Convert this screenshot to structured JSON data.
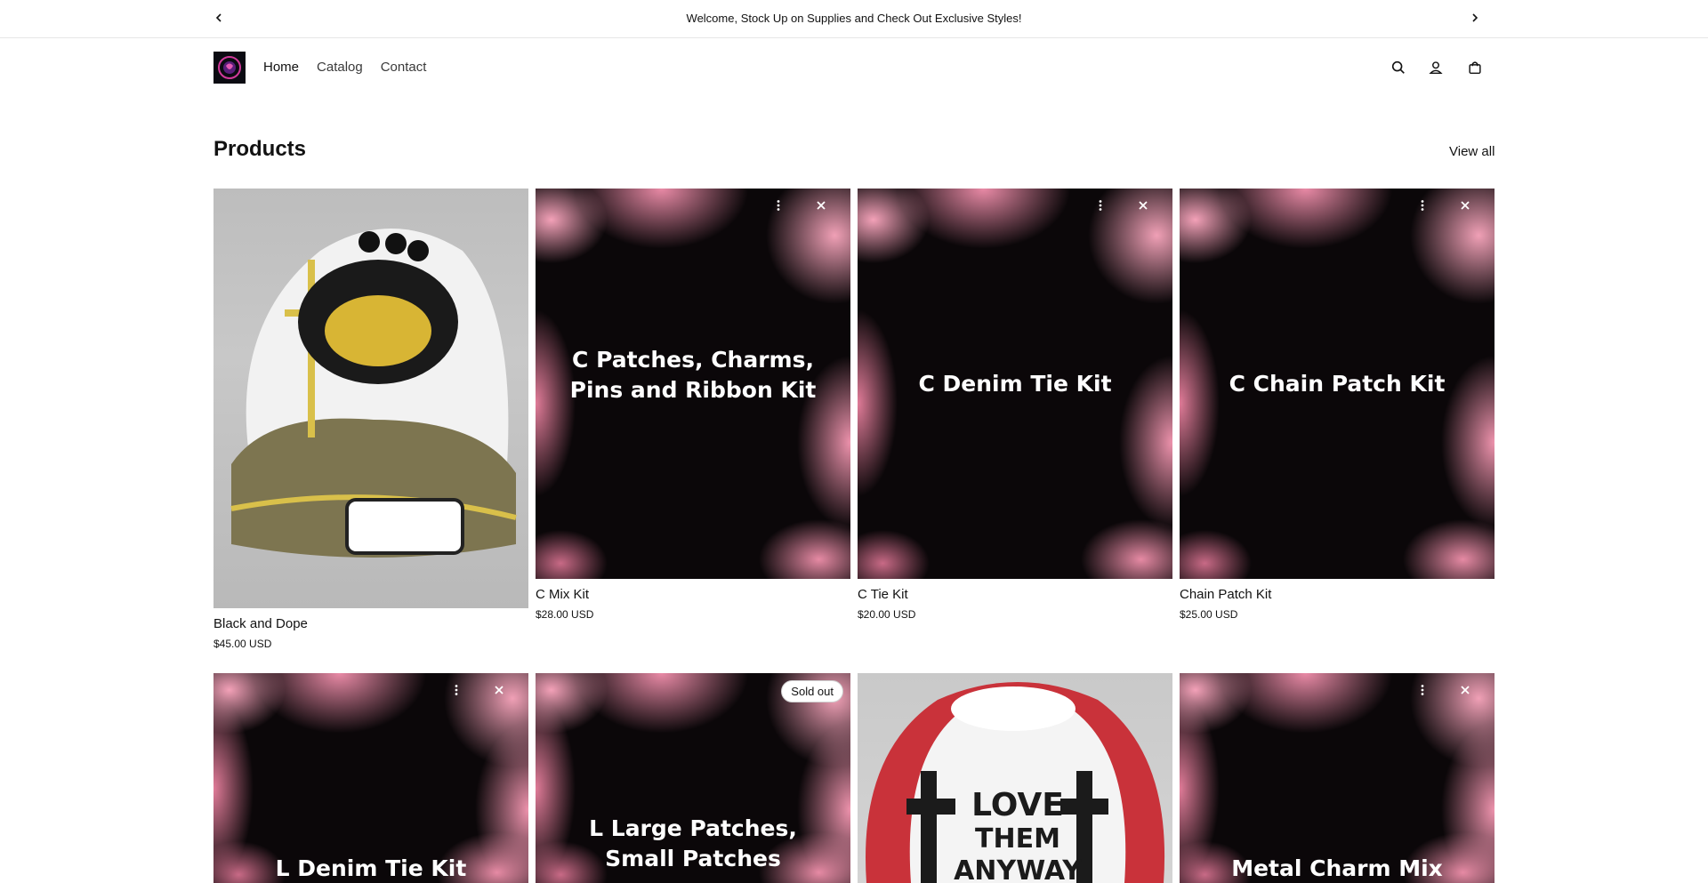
{
  "announcement": {
    "text": "Welcome, Stock Up on Supplies and Check Out Exclusive Styles!",
    "prev_icon": "chevron-left-icon",
    "next_icon": "chevron-right-icon"
  },
  "header": {
    "nav": [
      {
        "label": "Home"
      },
      {
        "label": "Catalog"
      },
      {
        "label": "Contact"
      }
    ],
    "icons": [
      "search-icon",
      "account-icon",
      "cart-icon"
    ]
  },
  "section": {
    "title": "Products",
    "view_all": "View all"
  },
  "products": [
    {
      "title": "Black and Dope",
      "price": "$45.00 USD",
      "image_text": ""
    },
    {
      "title": "C Mix Kit",
      "price": "$28.00 USD",
      "image_text": "C Patches, Charms, Pins and Ribbon Kit"
    },
    {
      "title": "C Tie Kit",
      "price": "$20.00 USD",
      "image_text": "C Denim Tie Kit"
    },
    {
      "title": "Chain Patch Kit",
      "price": "$25.00 USD",
      "image_text": "C Chain Patch Kit"
    },
    {
      "title": "",
      "price": "",
      "image_text": "L Denim Tie Kit"
    },
    {
      "title": "",
      "price": "",
      "image_text": "L Large Patches, Small Patches",
      "badge": "Sold out"
    },
    {
      "title": "",
      "price": "",
      "image_text": ""
    },
    {
      "title": "",
      "price": "",
      "image_text": "Metal Charm Mix"
    }
  ]
}
